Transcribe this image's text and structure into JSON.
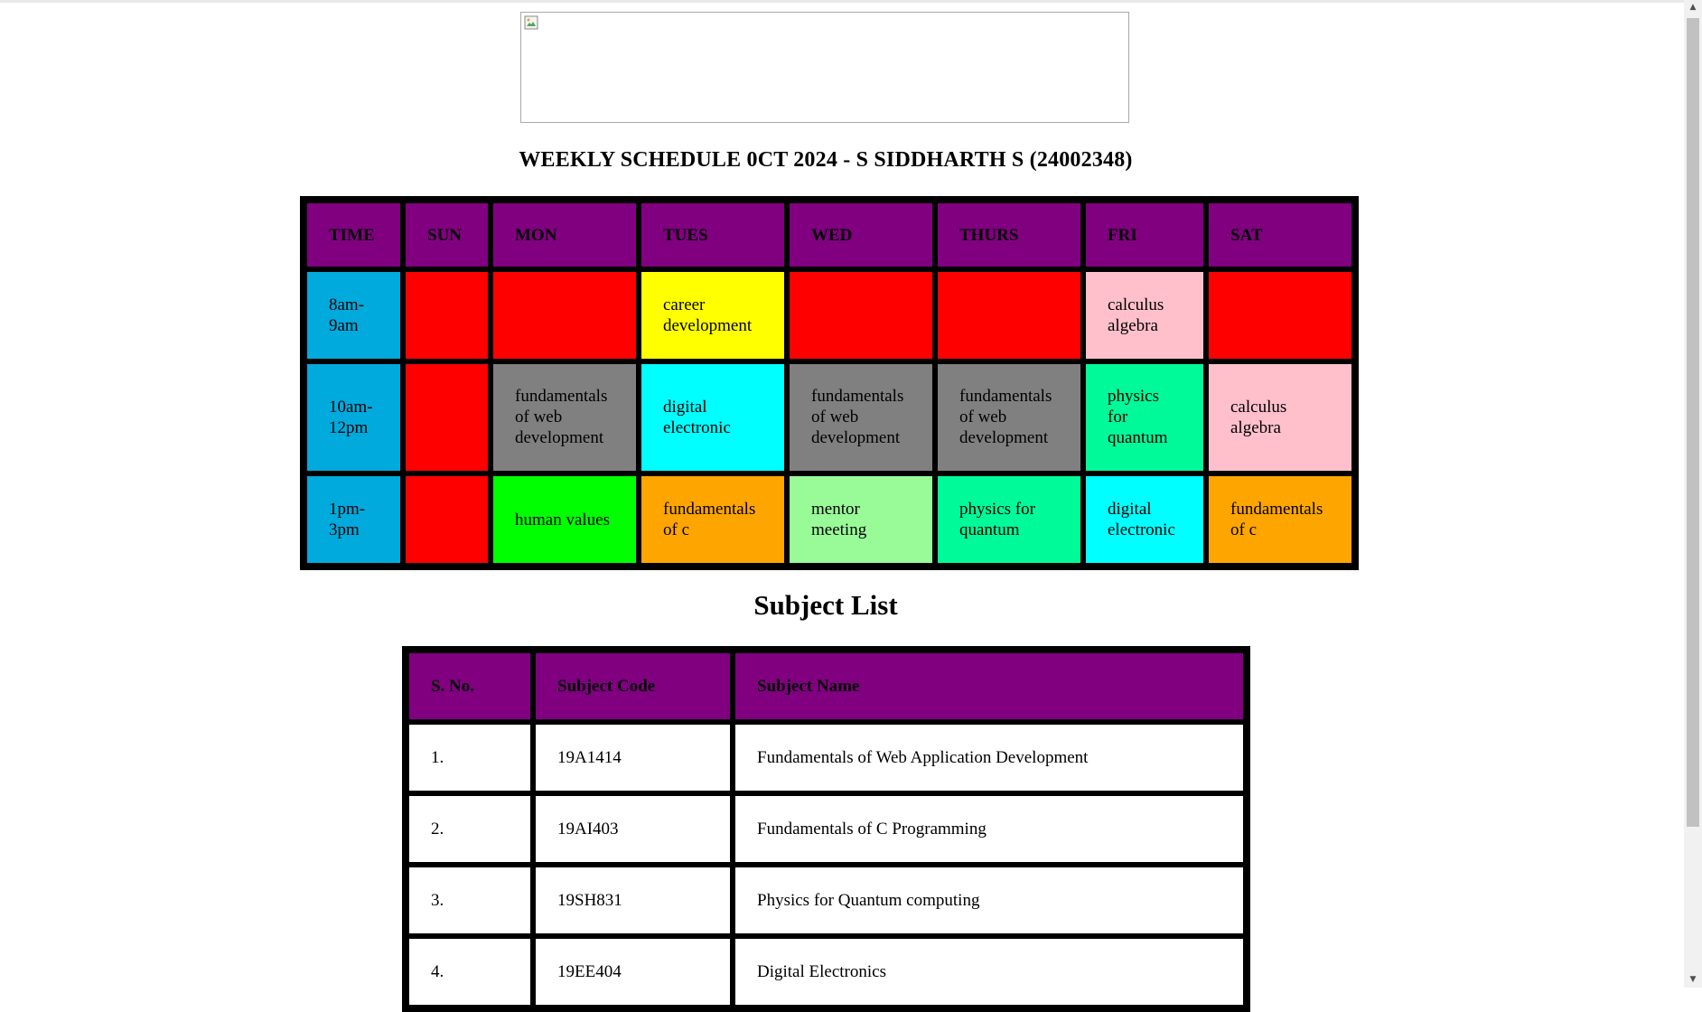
{
  "page": {
    "title": "WEEKLY SCHEDULE 0CT 2024 - S SIDDHARTH S (24002348)",
    "banner_icon": "broken-image-icon"
  },
  "schedule": {
    "headers": [
      "TIME",
      "SUN",
      "MON",
      "TUES",
      "WED",
      "THURS",
      "FRI",
      "SAT"
    ],
    "rows": [
      {
        "time": "8am-9am",
        "cells": [
          {
            "text": "",
            "color": "#ff0000"
          },
          {
            "text": "",
            "color": "#ff0000"
          },
          {
            "text": "career development",
            "color": "#ffff00"
          },
          {
            "text": "",
            "color": "#ff0000"
          },
          {
            "text": "",
            "color": "#ff0000"
          },
          {
            "text": "calculus algebra",
            "color": "#ffc0cb"
          },
          {
            "text": "",
            "color": "#ff0000"
          }
        ]
      },
      {
        "time": "10am-12pm",
        "cells": [
          {
            "text": "",
            "color": "#ff0000"
          },
          {
            "text": "fundamentals of web development",
            "color": "#808080"
          },
          {
            "text": "digital electronic",
            "color": "#00ffff"
          },
          {
            "text": "fundamentals of web development",
            "color": "#808080"
          },
          {
            "text": "fundamentals of web development",
            "color": "#808080"
          },
          {
            "text": "physics for quantum",
            "color": "#00fa9a"
          },
          {
            "text": "calculus algebra",
            "color": "#ffc0cb"
          }
        ]
      },
      {
        "time": "1pm-3pm",
        "cells": [
          {
            "text": "",
            "color": "#ff0000"
          },
          {
            "text": "human values",
            "color": "#00ff00"
          },
          {
            "text": "fundamentals of c",
            "color": "#ffa500"
          },
          {
            "text": "mentor meeting",
            "color": "#98fb98"
          },
          {
            "text": "physics for quantum",
            "color": "#00fa9a"
          },
          {
            "text": "digital electronic",
            "color": "#00ffff"
          },
          {
            "text": "fundamentals of c",
            "color": "#ffa500"
          }
        ]
      }
    ],
    "time_color": "#00aadd",
    "header_color": "#800080"
  },
  "subjects": {
    "heading": "Subject List",
    "headers": [
      "S. No.",
      "Subject Code",
      "Subject Name"
    ],
    "rows": [
      [
        "1.",
        "19A1414",
        "Fundamentals of Web Application Development"
      ],
      [
        "2.",
        "19AI403",
        "Fundamentals of C Programming"
      ],
      [
        "3.",
        "19SH831",
        "Physics for Quantum computing"
      ],
      [
        "4.",
        "19EE404",
        "Digital Electronics"
      ]
    ]
  },
  "scrollbar": {
    "up_icon": "chevron-up-icon",
    "down_icon": "chevron-down-icon",
    "up_glyph": "▲",
    "down_glyph": "▼"
  }
}
